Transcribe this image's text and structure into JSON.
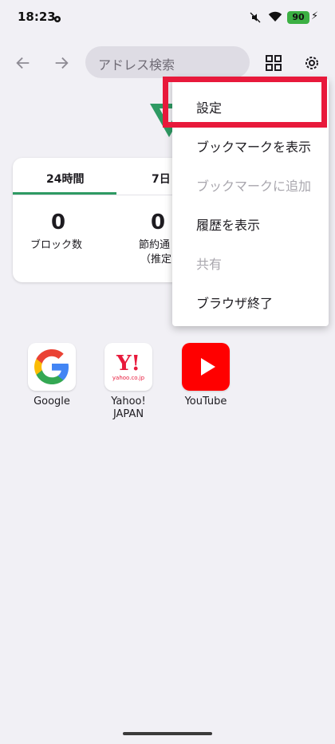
{
  "status_bar": {
    "time": "18:23",
    "battery": "90"
  },
  "toolbar": {
    "address_placeholder": "アドレス検索"
  },
  "stats": {
    "tabs": [
      "24時間",
      "7日"
    ],
    "blocked_count": "0",
    "blocked_label": "ブロック数",
    "saved_count": "0",
    "saved_label": "節約通",
    "saved_sub": "（推定"
  },
  "shortcuts": [
    {
      "label": "Google"
    },
    {
      "label": "Yahoo!\nJAPAN",
      "line1": "Yahoo!",
      "line2": "JAPAN",
      "icon_text": "Y!",
      "icon_sub": "yahoo.co.jp"
    },
    {
      "label": "YouTube"
    }
  ],
  "menu": {
    "items": [
      {
        "label": "設定",
        "enabled": true
      },
      {
        "label": "ブックマークを表示",
        "enabled": true
      },
      {
        "label": "ブックマークに追加",
        "enabled": false
      },
      {
        "label": "履歴を表示",
        "enabled": true
      },
      {
        "label": "共有",
        "enabled": false
      },
      {
        "label": "ブラウザ終了",
        "enabled": true
      }
    ]
  },
  "colors": {
    "accent": "#2e9a63",
    "highlight": "#e8193b",
    "background": "#f1f0f5"
  }
}
